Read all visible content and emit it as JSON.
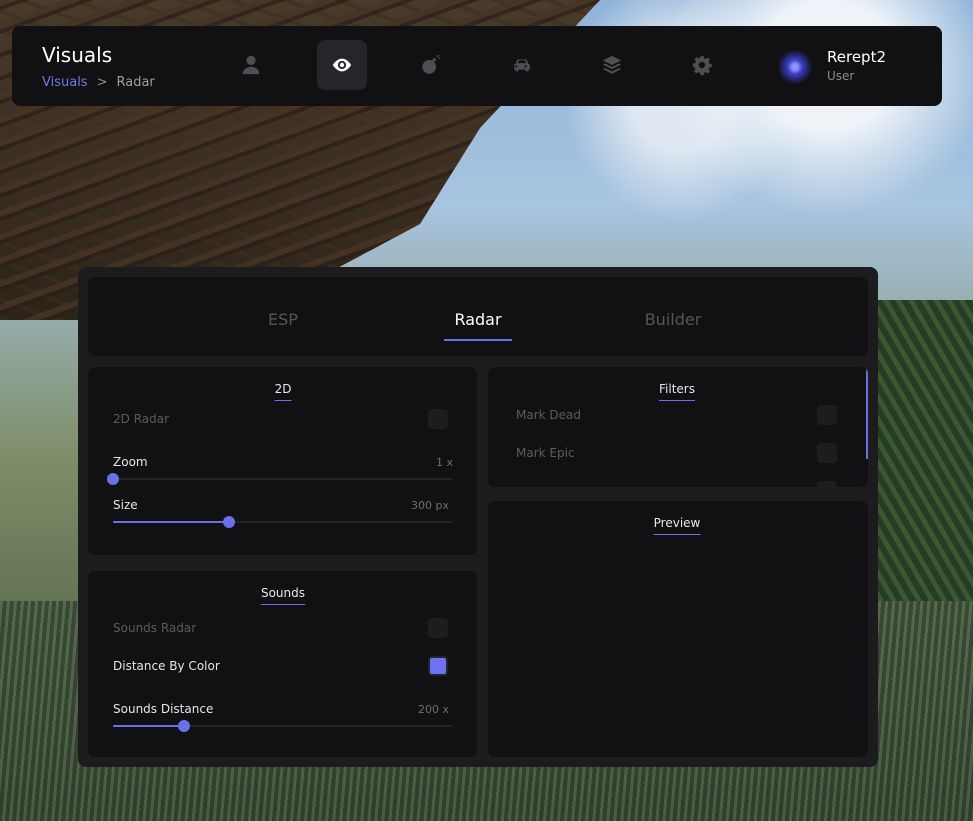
{
  "header": {
    "title": "Visuals",
    "breadcrumb": {
      "root": "Visuals",
      "separator": ">",
      "current": "Radar"
    },
    "nav": [
      {
        "icon": "user-icon",
        "active": false
      },
      {
        "icon": "eye-icon",
        "active": true
      },
      {
        "icon": "bomb-icon",
        "active": false
      },
      {
        "icon": "car-icon",
        "active": false
      },
      {
        "icon": "layers-icon",
        "active": false
      },
      {
        "icon": "gear-icon",
        "active": false
      }
    ],
    "user": {
      "name": "Rerept2",
      "role": "User"
    }
  },
  "tabs": [
    {
      "label": "ESP",
      "active": false
    },
    {
      "label": "Radar",
      "active": true
    },
    {
      "label": "Builder",
      "active": false
    }
  ],
  "radar2d": {
    "title": "2D",
    "enable_label": "2D Radar",
    "enable_checked": false,
    "zoom": {
      "label": "Zoom",
      "value_text": "1 x",
      "fraction": 0.0
    },
    "size": {
      "label": "Size",
      "value_text": "300 px",
      "fraction": 0.34
    }
  },
  "sounds": {
    "title": "Sounds",
    "enable_label": "Sounds Radar",
    "enable_checked": false,
    "distance_color_label": "Distance By Color",
    "distance_color_checked": true,
    "distance": {
      "label": "Sounds Distance",
      "value_text": "200 x",
      "fraction": 0.21
    }
  },
  "filters": {
    "title": "Filters",
    "items": [
      {
        "label": "Mark Dead",
        "checked": false
      },
      {
        "label": "Mark Epic",
        "checked": false
      }
    ]
  },
  "preview": {
    "title": "Preview"
  },
  "colors": {
    "accent": "#6a70e8",
    "panel": "#1c1c1e",
    "card": "#111113"
  }
}
